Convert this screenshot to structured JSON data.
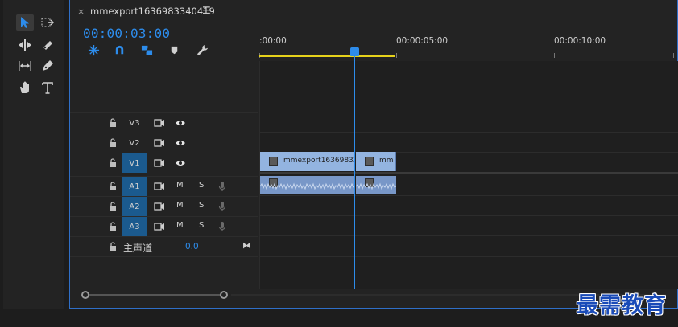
{
  "tab": {
    "close": "×",
    "title": "mmexport1636983340419",
    "menu": "☰"
  },
  "timecode": "00:00:03:00",
  "ruler": {
    "labels": [
      ":00:00",
      "00:00:05:00",
      "00:00:10:00"
    ]
  },
  "video_tracks": [
    {
      "name": "V3",
      "target": false
    },
    {
      "name": "V2",
      "target": false
    },
    {
      "name": "V1",
      "target": true
    }
  ],
  "audio_tracks": [
    {
      "name": "A1",
      "m": "M",
      "s": "S"
    },
    {
      "name": "A2",
      "m": "M",
      "s": "S"
    },
    {
      "name": "A3",
      "m": "M",
      "s": "S"
    }
  ],
  "master": {
    "name": "主声道",
    "value": "0.0"
  },
  "clips": {
    "v1_first": "mmexport16369833",
    "v1_second": "mm"
  },
  "watermark": "最需教育",
  "colors": {
    "accent": "#2d8ceb",
    "workarea": "#e6d21b",
    "clip_video": "#93b4e0",
    "clip_audio": "#7897c8",
    "track_target": "#1b5a8e"
  }
}
